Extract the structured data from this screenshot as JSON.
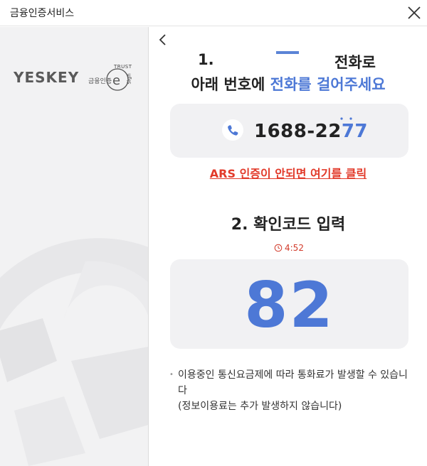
{
  "window": {
    "title": "금융인증서비스"
  },
  "brand": {
    "logo": "YESKEY",
    "sublabel": "금융인증",
    "trust_label": "TRUST",
    "sign_label": "Sign"
  },
  "step1": {
    "number": "1.",
    "word": "전화로",
    "prefix": "아래 번호에 ",
    "highlight": "전화를 걸어주세요",
    "phone_number": "1688-22",
    "phone_suffix": "77"
  },
  "ars_link": "ARS 인증이 안되면 여기를 클릭",
  "step2": {
    "title": "2. 확인코드 입력",
    "timer": "4:52",
    "code": "82"
  },
  "notice": {
    "line1": "이용중인 통신요금제에 따라 통화료가 발생할 수 있습니다",
    "line2": "(정보이용료는 추가 발생하지 않습니다)"
  },
  "colors": {
    "accent": "#4d78d6",
    "alert": "#e23a2a",
    "panel": "#f1f1f3"
  },
  "icons": [
    "close-icon",
    "back-arrow-icon",
    "phone-icon",
    "clock-icon"
  ]
}
